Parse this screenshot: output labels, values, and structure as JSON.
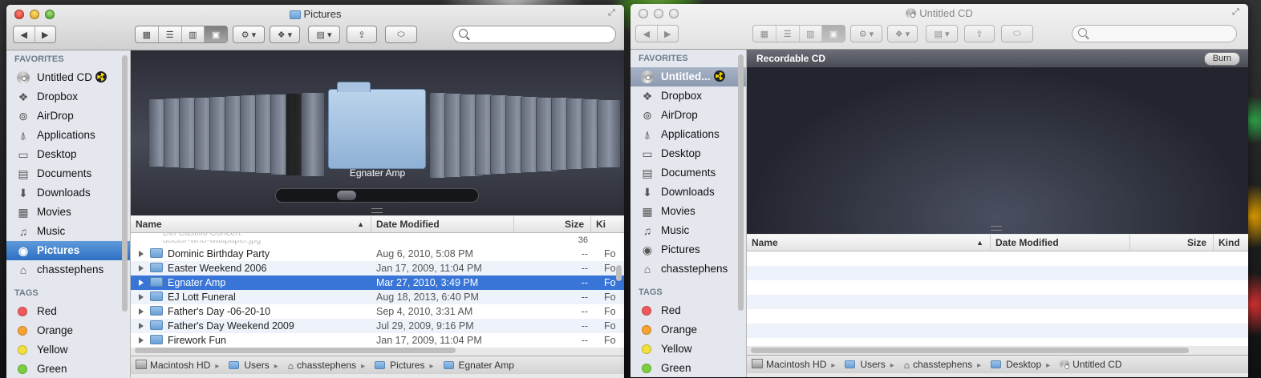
{
  "left_window": {
    "title": "Pictures",
    "toolbar": {
      "back": "◀",
      "forward": "▶",
      "view_icon": "▦",
      "view_list": "☰",
      "view_column": "▥",
      "view_coverflow": "▣",
      "action": "⚙ ▾",
      "dropbox": "❖ ▾",
      "arrange": "▤ ▾",
      "share": "⇪",
      "tags": "⬭"
    },
    "search_placeholder": "",
    "sidebar": {
      "favorites_label": "FAVORITES",
      "favorites": [
        {
          "label": "Untitled CD",
          "icon": "cd-icon"
        },
        {
          "label": "Dropbox",
          "icon": "dropbox-icon"
        },
        {
          "label": "AirDrop",
          "icon": "airdrop-icon"
        },
        {
          "label": "Applications",
          "icon": "applications-icon"
        },
        {
          "label": "Desktop",
          "icon": "desktop-icon"
        },
        {
          "label": "Documents",
          "icon": "documents-icon"
        },
        {
          "label": "Downloads",
          "icon": "downloads-icon"
        },
        {
          "label": "Movies",
          "icon": "movies-icon"
        },
        {
          "label": "Music",
          "icon": "music-icon"
        },
        {
          "label": "Pictures",
          "icon": "camera-icon"
        },
        {
          "label": "chasstephens",
          "icon": "home-icon"
        }
      ],
      "tags_label": "TAGS",
      "tags": [
        {
          "label": "Red",
          "color": "#f0595a"
        },
        {
          "label": "Orange",
          "color": "#f8a331"
        },
        {
          "label": "Yellow",
          "color": "#f3e13b"
        },
        {
          "label": "Green",
          "color": "#7bcf3e"
        }
      ]
    },
    "coverflow_title": "Egnater Amp",
    "columns": {
      "name": "Name",
      "date": "Date Modified",
      "size": "Size",
      "kind": "Ki"
    },
    "partial_rows": [
      "Del Castillo Concert",
      "doctor-who-wallpaper.jpg"
    ],
    "partial_size": "36",
    "rows": [
      {
        "name": "Dominic Birthday Party",
        "date": "Aug 6, 2010, 5:08 PM",
        "size": "--",
        "kind": "Fo"
      },
      {
        "name": "Easter Weekend 2006",
        "date": "Jan 17, 2009, 11:04 PM",
        "size": "--",
        "kind": "Fo"
      },
      {
        "name": "Egnater Amp",
        "date": "Mar 27, 2010, 3:49 PM",
        "size": "--",
        "kind": "Fo"
      },
      {
        "name": "EJ Lott Funeral",
        "date": "Aug 18, 2013, 6:40 PM",
        "size": "--",
        "kind": "Fo"
      },
      {
        "name": "Father's Day -06-20-10",
        "date": "Sep 4, 2010, 3:31 AM",
        "size": "--",
        "kind": "Fo"
      },
      {
        "name": "Father's Day Weekend 2009",
        "date": "Jul 29, 2009, 9:16 PM",
        "size": "--",
        "kind": "Fo"
      },
      {
        "name": "Firework Fun",
        "date": "Jan 17, 2009, 11:04 PM",
        "size": "--",
        "kind": "Fo"
      }
    ],
    "path": [
      "Macintosh HD",
      "Users",
      "chasstephens",
      "Pictures",
      "Egnater Amp"
    ]
  },
  "right_window": {
    "title": "Untitled CD",
    "burn_bar_label": "Recordable CD",
    "burn_button": "Burn",
    "sidebar": {
      "favorites_label": "FAVORITES",
      "favorites": [
        {
          "label": "Untitled...",
          "icon": "cd-icon"
        },
        {
          "label": "Dropbox",
          "icon": "dropbox-icon"
        },
        {
          "label": "AirDrop",
          "icon": "airdrop-icon"
        },
        {
          "label": "Applications",
          "icon": "applications-icon"
        },
        {
          "label": "Desktop",
          "icon": "desktop-icon"
        },
        {
          "label": "Documents",
          "icon": "documents-icon"
        },
        {
          "label": "Downloads",
          "icon": "downloads-icon"
        },
        {
          "label": "Movies",
          "icon": "movies-icon"
        },
        {
          "label": "Music",
          "icon": "music-icon"
        },
        {
          "label": "Pictures",
          "icon": "camera-icon"
        },
        {
          "label": "chasstephens",
          "icon": "home-icon"
        }
      ],
      "tags_label": "TAGS",
      "tags": [
        {
          "label": "Red",
          "color": "#f0595a"
        },
        {
          "label": "Orange",
          "color": "#f8a331"
        },
        {
          "label": "Yellow",
          "color": "#f3e13b"
        },
        {
          "label": "Green",
          "color": "#7bcf3e"
        }
      ]
    },
    "columns": {
      "name": "Name",
      "date": "Date Modified",
      "size": "Size",
      "kind": "Kind"
    },
    "path": [
      "Macintosh HD",
      "Users",
      "chasstephens",
      "Desktop",
      "Untitled CD"
    ]
  },
  "icons": {
    "cd-icon": "◎",
    "dropbox-icon": "❖",
    "airdrop-icon": "⊚",
    "applications-icon": "⍋",
    "desktop-icon": "▭",
    "documents-icon": "▤",
    "downloads-icon": "⬇",
    "movies-icon": "▦",
    "music-icon": "♫",
    "camera-icon": "◉",
    "home-icon": "⌂"
  },
  "colors": {
    "selection": "#3875d7",
    "sidebar_selection": "#2d6fc4"
  }
}
